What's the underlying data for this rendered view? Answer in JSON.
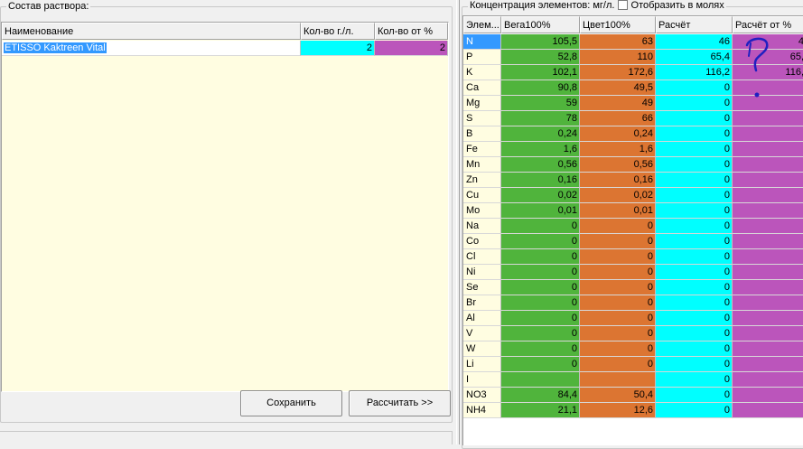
{
  "left_panel": {
    "title": "Состав раствора:",
    "columns": [
      "Наименование",
      "Кол-во г./л.",
      "Кол-во от %"
    ],
    "rows": [
      {
        "name": "ETISSO Kaktreen Vital",
        "qty_gl": "2",
        "qty_pct": "2"
      }
    ],
    "save_label": "Сохранить",
    "calc_label": "Рассчитать >>"
  },
  "right_panel": {
    "title": "Концентрация элементов: мг/л.",
    "moles_label": "Отобразить в молях",
    "columns": [
      "Элем...",
      "Вега100%",
      "Цвет100%",
      "Расчёт",
      "Расчёт от %"
    ],
    "rows": [
      {
        "el": "N",
        "vega": "105,5",
        "color": "63",
        "calc": "46",
        "pct": "4"
      },
      {
        "el": "P",
        "vega": "52,8",
        "color": "110",
        "calc": "65,4",
        "pct": "65,"
      },
      {
        "el": "K",
        "vega": "102,1",
        "color": "172,6",
        "calc": "116,2",
        "pct": "116,"
      },
      {
        "el": "Ca",
        "vega": "90,8",
        "color": "49,5",
        "calc": "0",
        "pct": ""
      },
      {
        "el": "Mg",
        "vega": "59",
        "color": "49",
        "calc": "0",
        "pct": ""
      },
      {
        "el": "S",
        "vega": "78",
        "color": "66",
        "calc": "0",
        "pct": ""
      },
      {
        "el": "B",
        "vega": "0,24",
        "color": "0,24",
        "calc": "0",
        "pct": ""
      },
      {
        "el": "Fe",
        "vega": "1,6",
        "color": "1,6",
        "calc": "0",
        "pct": ""
      },
      {
        "el": "Mn",
        "vega": "0,56",
        "color": "0,56",
        "calc": "0",
        "pct": ""
      },
      {
        "el": "Zn",
        "vega": "0,16",
        "color": "0,16",
        "calc": "0",
        "pct": ""
      },
      {
        "el": "Cu",
        "vega": "0,02",
        "color": "0,02",
        "calc": "0",
        "pct": ""
      },
      {
        "el": "Mo",
        "vega": "0,01",
        "color": "0,01",
        "calc": "0",
        "pct": ""
      },
      {
        "el": "Na",
        "vega": "0",
        "color": "0",
        "calc": "0",
        "pct": ""
      },
      {
        "el": "Co",
        "vega": "0",
        "color": "0",
        "calc": "0",
        "pct": ""
      },
      {
        "el": "Cl",
        "vega": "0",
        "color": "0",
        "calc": "0",
        "pct": ""
      },
      {
        "el": "Ni",
        "vega": "0",
        "color": "0",
        "calc": "0",
        "pct": ""
      },
      {
        "el": "Se",
        "vega": "0",
        "color": "0",
        "calc": "0",
        "pct": ""
      },
      {
        "el": "Br",
        "vega": "0",
        "color": "0",
        "calc": "0",
        "pct": ""
      },
      {
        "el": "Al",
        "vega": "0",
        "color": "0",
        "calc": "0",
        "pct": ""
      },
      {
        "el": "V",
        "vega": "0",
        "color": "0",
        "calc": "0",
        "pct": ""
      },
      {
        "el": "W",
        "vega": "0",
        "color": "0",
        "calc": "0",
        "pct": ""
      },
      {
        "el": "Li",
        "vega": "0",
        "color": "0",
        "calc": "0",
        "pct": ""
      },
      {
        "el": "I",
        "vega": "",
        "color": "",
        "calc": "0",
        "pct": ""
      },
      {
        "el": "NO3",
        "vega": "84,4",
        "color": "50,4",
        "calc": "0",
        "pct": ""
      },
      {
        "el": "NH4",
        "vega": "21,1",
        "color": "12,6",
        "calc": "0",
        "pct": ""
      }
    ]
  },
  "colors": {
    "grid_bg": "#fffde1",
    "qty_gl": "#00ffff",
    "qty_pct": "#bb55bb",
    "vega": "#50b43c",
    "color100": "#dc7532",
    "calc": "#00ffff",
    "calc_pct": "#bb55bb",
    "selection": "#3399ff",
    "question_mark": "#2020c0"
  },
  "icons": [
    "question-mark-annotation-icon",
    "checkbox-icon"
  ]
}
